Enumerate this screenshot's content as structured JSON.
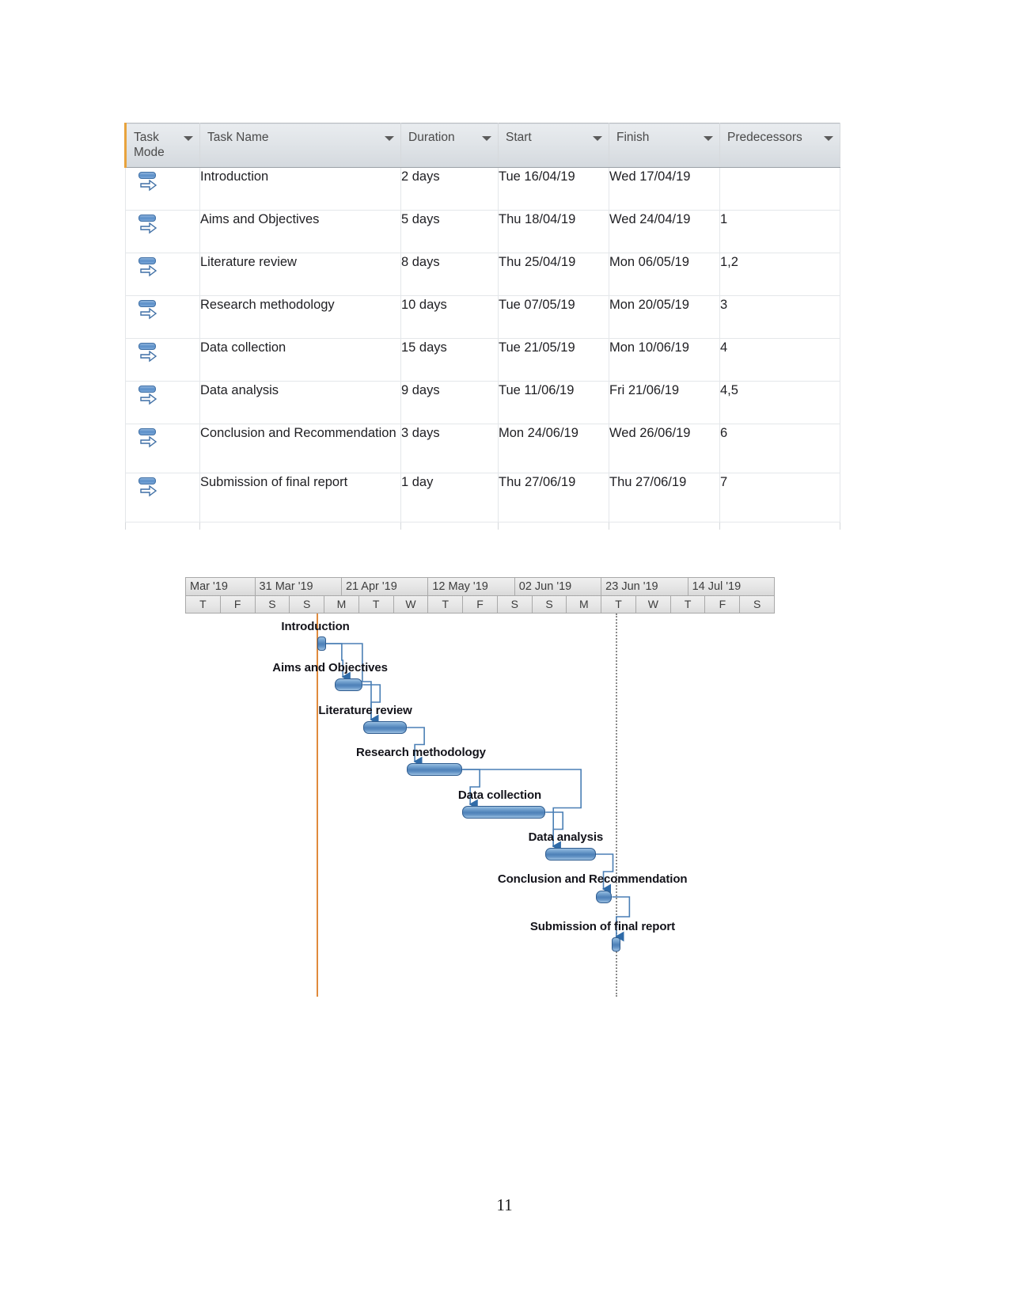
{
  "document": {
    "page_number": "11"
  },
  "task_table": {
    "columns": [
      {
        "key": "mode",
        "label": "Task\nMode",
        "has_filter": true
      },
      {
        "key": "name",
        "label": "Task Name",
        "has_filter": true
      },
      {
        "key": "dur",
        "label": "Duration",
        "has_filter": true
      },
      {
        "key": "start",
        "label": "Start",
        "has_filter": true
      },
      {
        "key": "fin",
        "label": "Finish",
        "has_filter": true
      },
      {
        "key": "pred",
        "label": "Predecessors",
        "has_filter": true
      }
    ],
    "mode_icon": "auto-scheduled-icon",
    "rows": [
      {
        "id": 1,
        "mode": "Auto Scheduled",
        "name": "Introduction",
        "duration": "2 days",
        "start": "Tue 16/04/19",
        "finish": "Wed 17/04/19",
        "predecessors": ""
      },
      {
        "id": 2,
        "mode": "Auto Scheduled",
        "name": "Aims and Objectives",
        "duration": "5 days",
        "start": "Thu 18/04/19",
        "finish": "Wed 24/04/19",
        "predecessors": "1"
      },
      {
        "id": 3,
        "mode": "Auto Scheduled",
        "name": "Literature review",
        "duration": "8 days",
        "start": "Thu 25/04/19",
        "finish": "Mon 06/05/19",
        "predecessors": "1,2"
      },
      {
        "id": 4,
        "mode": "Auto Scheduled",
        "name": "Research methodology",
        "duration": "10 days",
        "start": "Tue 07/05/19",
        "finish": "Mon 20/05/19",
        "predecessors": "3"
      },
      {
        "id": 5,
        "mode": "Auto Scheduled",
        "name": "Data collection",
        "duration": "15 days",
        "start": "Tue 21/05/19",
        "finish": "Mon 10/06/19",
        "predecessors": "4"
      },
      {
        "id": 6,
        "mode": "Auto Scheduled",
        "name": "Data analysis",
        "duration": "9 days",
        "start": "Tue 11/06/19",
        "finish": "Fri 21/06/19",
        "predecessors": "4,5"
      },
      {
        "id": 7,
        "mode": "Auto Scheduled",
        "name": "Conclusion and Recommendation",
        "duration": "3 days",
        "start": "Mon 24/06/19",
        "finish": "Wed 26/06/19",
        "predecessors": "6"
      },
      {
        "id": 8,
        "mode": "Auto Scheduled",
        "name": "Submission of final report",
        "duration": "1 day",
        "start": "Thu 27/06/19",
        "finish": "Thu 27/06/19",
        "predecessors": "7"
      }
    ]
  },
  "chart_data": {
    "type": "bar",
    "chart_kind": "gantt",
    "title": "",
    "xlabel": "",
    "ylabel": "",
    "grid": true,
    "legend_position": "none",
    "timeline": {
      "major_ticks": [
        "Mar '19",
        "31 Mar '19",
        "21 Apr '19",
        "12 May '19",
        "02 Jun '19",
        "23 Jun '19",
        "14 Jul '19"
      ],
      "minor_ticks": [
        "T",
        "F",
        "S",
        "S",
        "M",
        "T",
        "W",
        "T",
        "F",
        "S",
        "S",
        "M",
        "T",
        "W",
        "T",
        "F",
        "S"
      ],
      "axis_range": [
        "Mar '19",
        "14 Jul '19"
      ],
      "today_marker_color": "#e08a3c",
      "status_marker_style": "dotted"
    },
    "bar_color": "#4e81b8",
    "tasks": [
      {
        "name": "Introduction",
        "duration_days": 2,
        "start": "Tue 16/04/19",
        "finish": "Wed 17/04/19",
        "bar_left_pct": 22.4,
        "bar_width_pct": 1.6,
        "label_left_pct": 16.3,
        "row": 0,
        "milestone_like": true
      },
      {
        "name": "Aims and Objectives",
        "duration_days": 5,
        "start": "Thu 18/04/19",
        "finish": "Wed 24/04/19",
        "bar_left_pct": 25.4,
        "bar_width_pct": 4.7,
        "label_left_pct": 14.8,
        "row": 1,
        "milestone_like": false
      },
      {
        "name": "Literature review",
        "duration_days": 8,
        "start": "Thu 25/04/19",
        "finish": "Mon 06/05/19",
        "bar_left_pct": 30.2,
        "bar_width_pct": 7.4,
        "label_left_pct": 22.6,
        "row": 2,
        "milestone_like": false
      },
      {
        "name": "Research methodology",
        "duration_days": 10,
        "start": "Tue 07/05/19",
        "finish": "Mon 20/05/19",
        "bar_left_pct": 37.6,
        "bar_width_pct": 9.4,
        "label_left_pct": 29.0,
        "row": 3,
        "milestone_like": false
      },
      {
        "name": "Data collection",
        "duration_days": 15,
        "start": "Tue 21/05/19",
        "finish": "Mon 10/06/19",
        "bar_left_pct": 47.0,
        "bar_width_pct": 14.1,
        "label_left_pct": 46.3,
        "row": 4,
        "milestone_like": false
      },
      {
        "name": "Data analysis",
        "duration_days": 9,
        "start": "Tue 11/06/19",
        "finish": "Fri 21/06/19",
        "bar_left_pct": 61.1,
        "bar_width_pct": 8.5,
        "label_left_pct": 58.2,
        "row": 5,
        "milestone_like": false
      },
      {
        "name": "Conclusion and Recommendation",
        "duration_days": 3,
        "start": "Mon 24/06/19",
        "finish": "Wed 26/06/19",
        "bar_left_pct": 69.6,
        "bar_width_pct": 2.8,
        "label_left_pct": 53.0,
        "row": 6,
        "milestone_like": true
      },
      {
        "name": "Submission of final report",
        "duration_days": 1,
        "start": "Thu 27/06/19",
        "finish": "Thu 27/06/19",
        "bar_left_pct": 72.4,
        "bar_width_pct": 0.9,
        "label_left_pct": 58.5,
        "row": 7,
        "milestone_like": true
      }
    ],
    "dependencies": [
      {
        "from": "Introduction",
        "to": "Aims and Objectives"
      },
      {
        "from": "Introduction",
        "to": "Literature review"
      },
      {
        "from": "Aims and Objectives",
        "to": "Literature review"
      },
      {
        "from": "Literature review",
        "to": "Research methodology"
      },
      {
        "from": "Research methodology",
        "to": "Data collection"
      },
      {
        "from": "Research methodology",
        "to": "Data analysis"
      },
      {
        "from": "Data collection",
        "to": "Data analysis"
      },
      {
        "from": "Data analysis",
        "to": "Conclusion and Recommendation"
      },
      {
        "from": "Conclusion and Recommendation",
        "to": "Submission of final report"
      }
    ]
  }
}
